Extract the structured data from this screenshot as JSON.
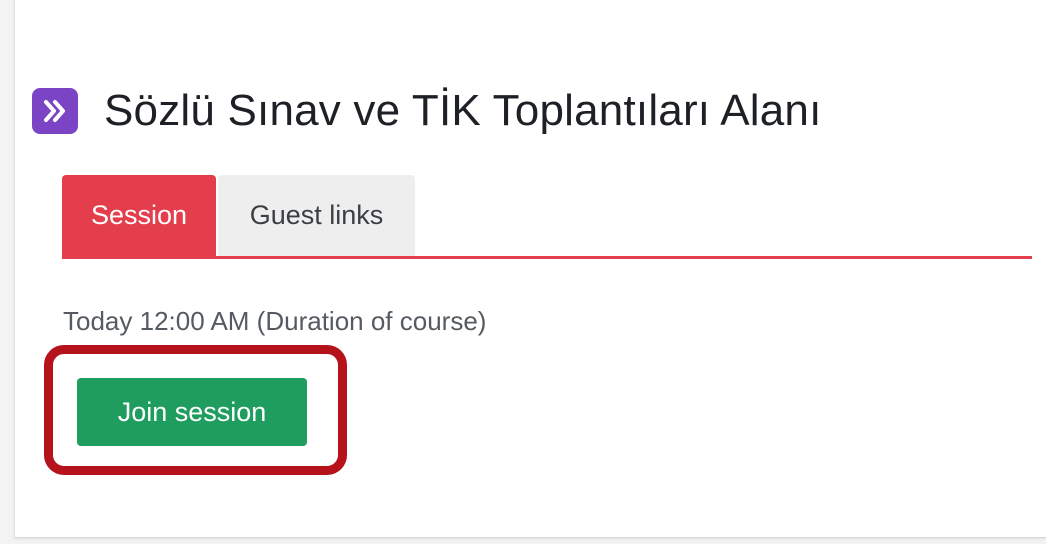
{
  "activity": {
    "icon": "bigbluebutton-activity-icon",
    "icon_color": "#7b44c4",
    "title": "Sözlü Sınav ve TİK Toplantıları Alanı"
  },
  "tabs": [
    {
      "label": "Session",
      "active": true,
      "color": "#e43d4b"
    },
    {
      "label": "Guest links",
      "active": false
    }
  ],
  "session": {
    "time_text": "Today 12:00 AM (Duration of course)",
    "join_label": "Join session",
    "join_color": "#1f9d5f"
  },
  "annotation": {
    "highlight_color": "#b5121b"
  }
}
